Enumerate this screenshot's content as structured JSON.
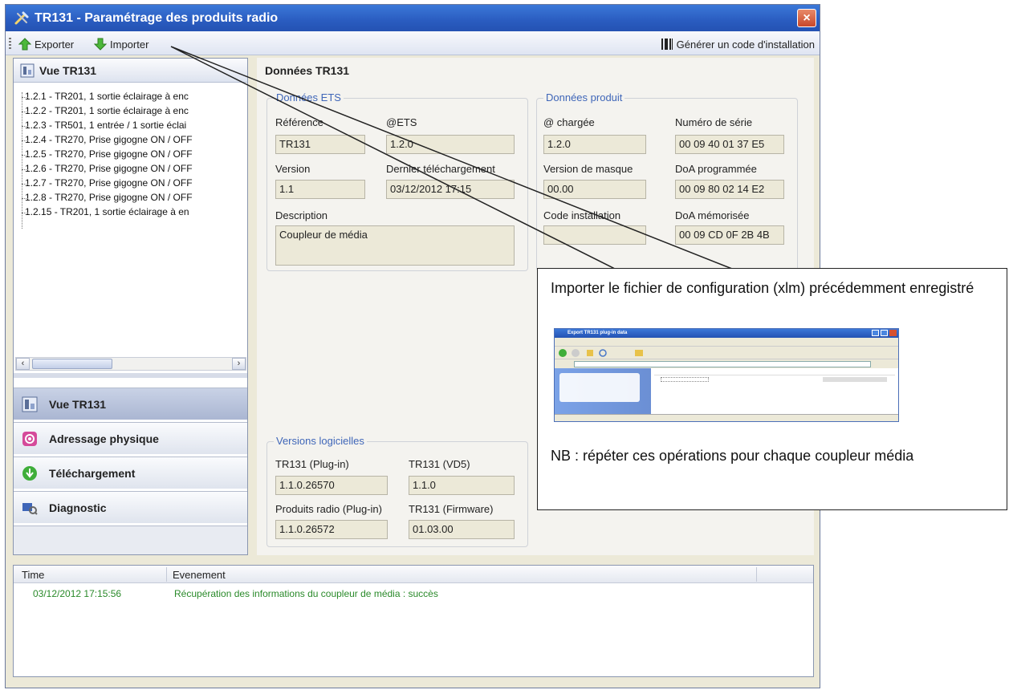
{
  "window": {
    "title": "TR131 - Paramétrage des produits radio",
    "close_label": "×"
  },
  "toolbar": {
    "export_label": "Exporter",
    "import_label": "Importer",
    "generate_label": "Générer un code d'installation"
  },
  "left_panel": {
    "header": "Vue TR131",
    "tree_items": [
      "1.2.1 - TR201, 1 sortie éclairage à enc",
      "1.2.2 - TR201, 1 sortie éclairage à enc",
      "1.2.3 - TR501, 1 entrée / 1 sortie éclai",
      "1.2.4 - TR270, Prise gigogne ON / OFF",
      "1.2.5 - TR270, Prise gigogne ON / OFF",
      "1.2.6 - TR270, Prise gigogne ON / OFF",
      "1.2.7 - TR270, Prise gigogne ON / OFF",
      "1.2.8 - TR270, Prise gigogne ON / OFF",
      "1.2.15 - TR201, 1 sortie éclairage à en"
    ],
    "nav": [
      {
        "label": "Vue TR131",
        "active": true
      },
      {
        "label": "Adressage physique"
      },
      {
        "label": "Téléchargement"
      },
      {
        "label": "Diagnostic"
      }
    ]
  },
  "main": {
    "section_title": "Données TR131",
    "ets": {
      "group_title": "Données ETS",
      "ref_label": "Référence",
      "ref_value": "TR131",
      "ets_label": "@ETS",
      "ets_value": "1.2.0",
      "version_label": "Version",
      "version_value": "1.1",
      "last_label": "Dernier téléchargement",
      "last_value": "03/12/2012 17:15",
      "desc_label": "Description",
      "desc_value": "Coupleur de média"
    },
    "product": {
      "group_title": "Données produit",
      "loaded_label": "@ chargée",
      "loaded_value": "1.2.0",
      "serial_label": "Numéro de série",
      "serial_value": "00 09 40 01 37 E5",
      "mask_label": "Version de masque",
      "mask_value": "00.00",
      "doa_prog_label": "DoA programmée",
      "doa_prog_value": "00 09 80 02 14 E2",
      "install_label": "Code installation",
      "doa_mem_label": "DoA mémorisée",
      "doa_mem_value": "00 09 CD 0F 2B 4B"
    },
    "versions": {
      "group_title": "Versions logicielles",
      "plugin_label": "TR131 (Plug-in)",
      "plugin_value": "1.1.0.26570",
      "vd5_label": "TR131 (VD5)",
      "vd5_value": "1.1.0",
      "radio_label": "Produits radio (Plug-in)",
      "radio_value": "1.1.0.26572",
      "fw_label": "TR131 (Firmware)",
      "fw_value": "01.03.00"
    }
  },
  "log": {
    "col_time": "Time",
    "col_event": "Evenement",
    "rows": [
      {
        "time": "03/12/2012 17:15:56",
        "event": "Récupération des informations du coupleur de média : succès"
      }
    ]
  },
  "callout": {
    "title": "Importer le fichier de configuration (xlm) précédemment enregistré",
    "note": "NB : répéter ces opérations pour chaque coupleur média",
    "mini_window_title": "Export TR131 plug-in data"
  },
  "colors": {
    "title_bar": "#2a5cc0",
    "group_title": "#3f66b8",
    "log_success": "#2a8a2a"
  }
}
